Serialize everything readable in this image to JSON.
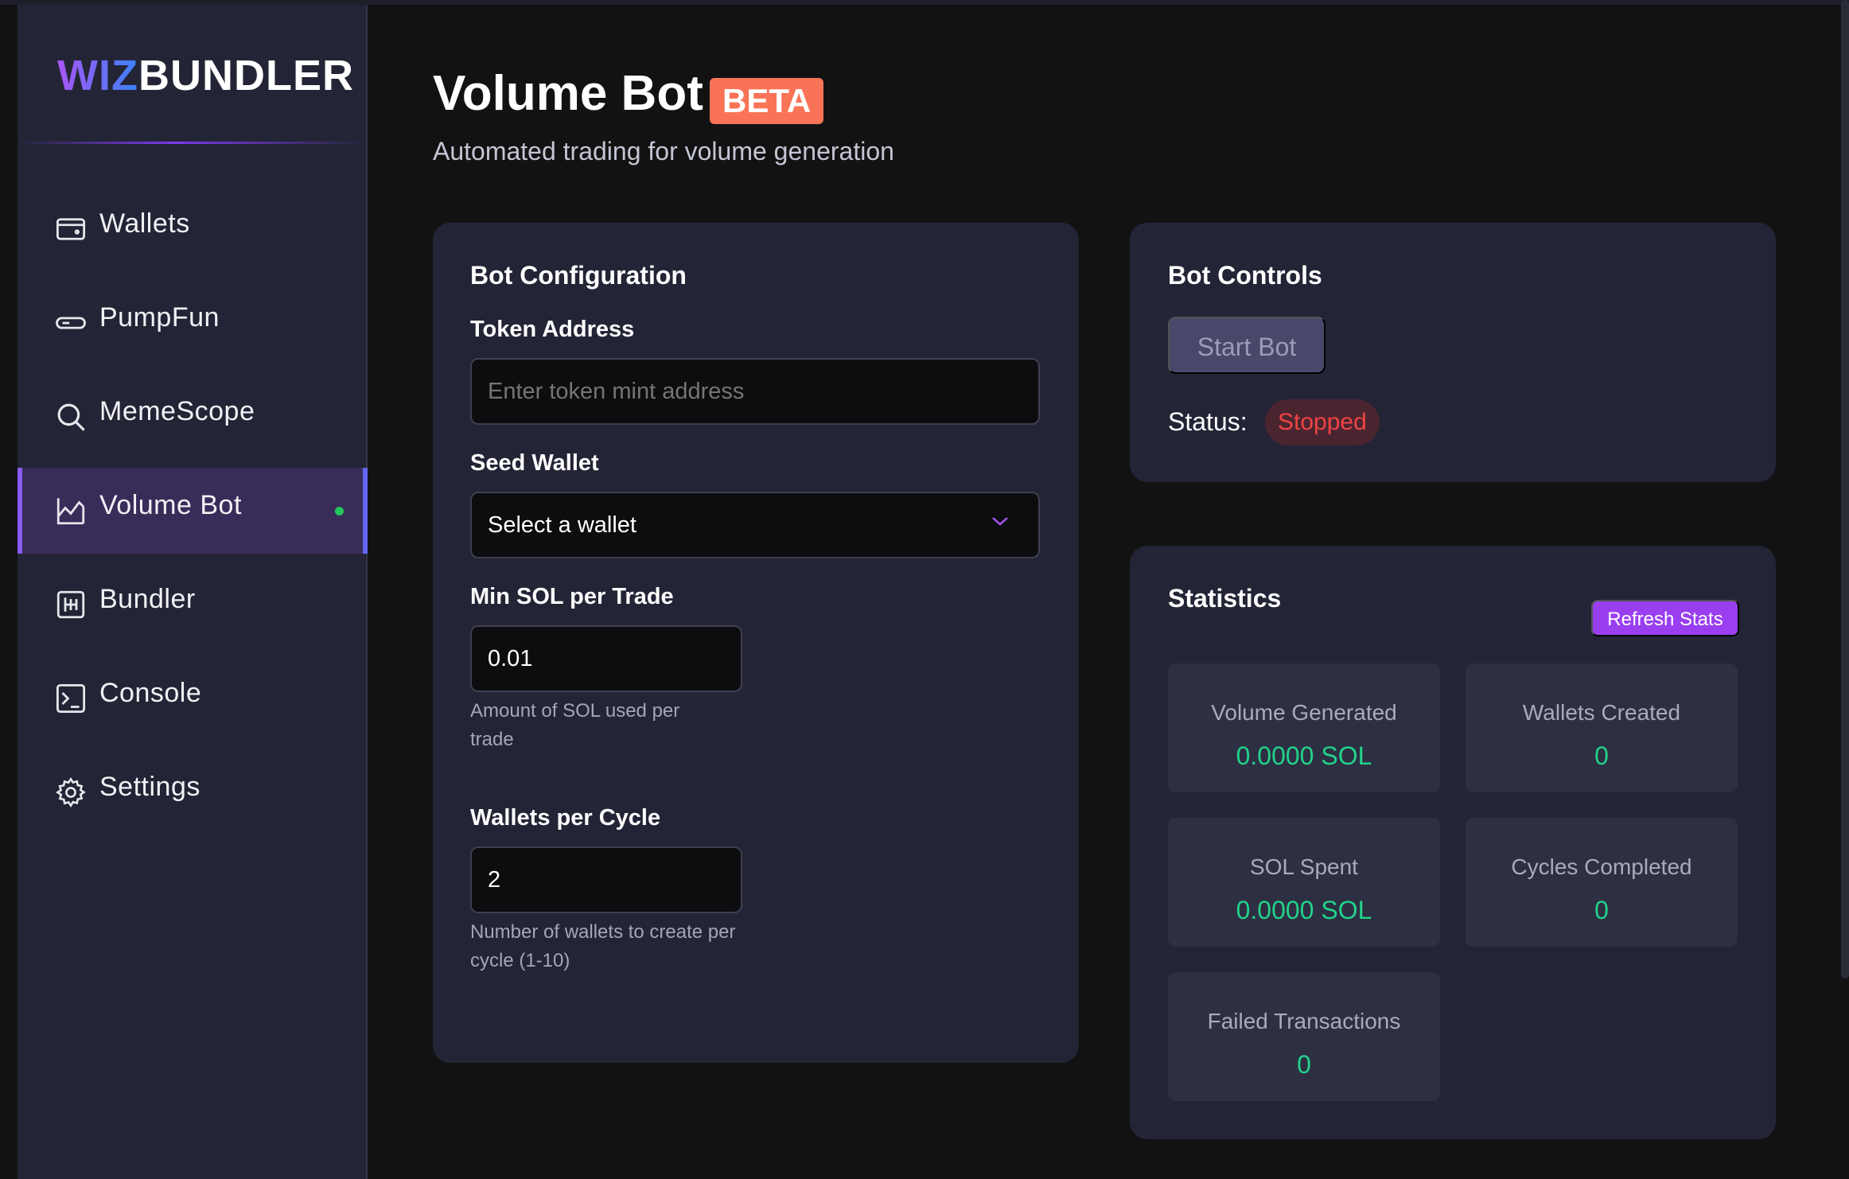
{
  "app": {
    "logo_part1": "WIZ",
    "logo_part2": "BUNDLER"
  },
  "sidebar": {
    "items": [
      {
        "label": "Wallets",
        "icon": "wallet-icon"
      },
      {
        "label": "PumpFun",
        "icon": "pill-icon"
      },
      {
        "label": "MemeScope",
        "icon": "search-icon"
      },
      {
        "label": "Volume Bot",
        "icon": "chart-icon",
        "active": true
      },
      {
        "label": "Bundler",
        "icon": "bundler-icon"
      },
      {
        "label": "Console",
        "icon": "terminal-icon"
      },
      {
        "label": "Settings",
        "icon": "gear-icon"
      }
    ]
  },
  "header": {
    "title": "Volume Bot",
    "badge": "BETA",
    "subtitle": "Automated trading for volume generation"
  },
  "config": {
    "title": "Bot Configuration",
    "token_label": "Token Address",
    "token_placeholder": "Enter token mint address",
    "seed_label": "Seed Wallet",
    "seed_value": "Select a wallet",
    "min_sol_label": "Min SOL per Trade",
    "min_sol_value": "0.01",
    "min_sol_hint": "Amount of SOL used per trade",
    "wallets_label": "Wallets per Cycle",
    "wallets_value": "2",
    "wallets_hint": "Number of wallets to create per cycle (1-10)"
  },
  "controls": {
    "title": "Bot Controls",
    "start_label": "Start Bot",
    "status_label": "Status:",
    "status_value": "Stopped"
  },
  "statistics": {
    "title": "Statistics",
    "refresh_label": "Refresh Stats",
    "items": [
      {
        "label": "Volume Generated",
        "value": "0.0000 SOL"
      },
      {
        "label": "Wallets Created",
        "value": "0"
      },
      {
        "label": "SOL Spent",
        "value": "0.0000 SOL"
      },
      {
        "label": "Cycles Completed",
        "value": "0"
      },
      {
        "label": "Failed Transactions",
        "value": "0"
      }
    ]
  },
  "colors": {
    "accent": "#8b5cf6",
    "beta": "#f97357",
    "stat_value": "#22d28a",
    "status_stopped": "#ef4444"
  }
}
